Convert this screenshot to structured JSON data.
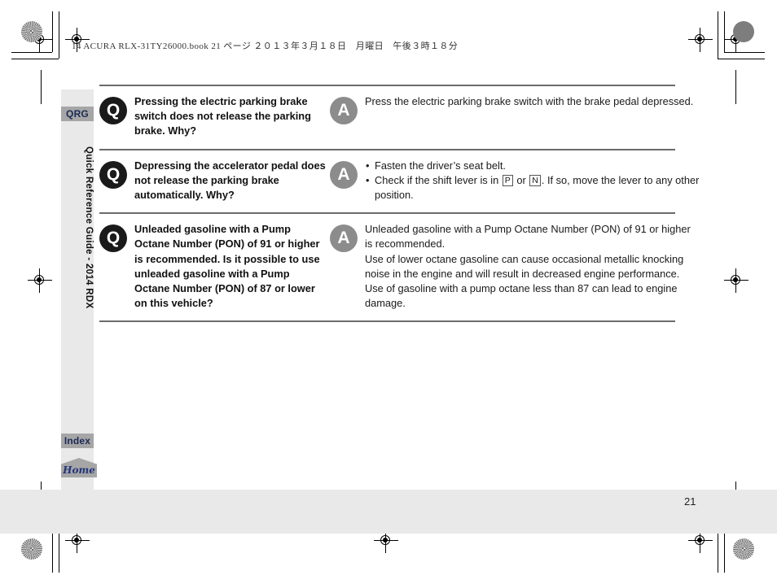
{
  "job_header": "14 ACURA RLX-31TY26000.book  21 ページ  ２０１３年３月１８日　月曜日　午後３時１８分",
  "sidebar": {
    "tab_qrg": "QRG",
    "vertical_label": "Quick Reference Guide - 2014 RDX",
    "tab_index": "Index",
    "home_label": "Home"
  },
  "badges": {
    "question": "Q",
    "answer": "A"
  },
  "qa": [
    {
      "question": "Pressing the electric parking brake switch does not release the parking brake. Why?",
      "answer_lines": [
        "Press the electric parking brake switch with the brake pedal depressed."
      ],
      "answer_type": "paragraph"
    },
    {
      "question": "Depressing the accelerator pedal does not release the parking brake automatically. Why?",
      "answer_type": "bullets",
      "bullets": [
        {
          "pre": "Fasten the driver’s seat belt.",
          "gears": []
        },
        {
          "pre": "Check if the shift lever is in ",
          "gear1": "P",
          "mid": " or ",
          "gear2": "N",
          "post": ". If so, move the lever to any other position."
        }
      ]
    },
    {
      "question": "Unleaded gasoline with a Pump Octane Number (PON) of 91 or higher is recommended. Is it possible to use unleaded gasoline with a Pump Octane Number (PON) of 87 or lower on this vehicle?",
      "answer_type": "paragraph",
      "answer_lines": [
        "Unleaded gasoline with a Pump Octane Number (PON) of 91 or higher is recommended.",
        "Use of lower octane gasoline can cause occasional metallic knocking noise in the engine and will result in decreased engine performance.",
        "Use of gasoline with a pump octane less than 87 can lead to engine damage."
      ]
    }
  ],
  "footer": {
    "page_number": "21"
  },
  "colors": {
    "tab_gray": "#a6a6a6",
    "tab_text": "#1b2a55",
    "band_gray": "#e9e9e9",
    "badge_q": "#1a1a1a",
    "badge_a": "#8c8c8c",
    "rule": "#6b6b6b",
    "home_text": "#23357a"
  }
}
